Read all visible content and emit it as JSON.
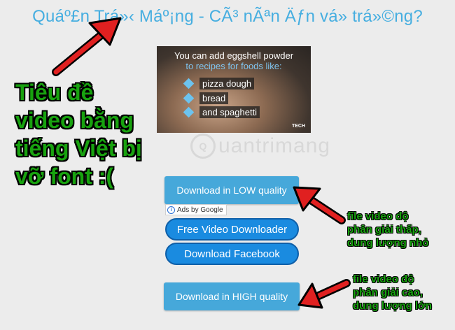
{
  "page": {
    "title": "Quáº£n Trá»‹ Máº¡ng - CÃ³ nÃªn Äƒn vá» trá»©ng?"
  },
  "annotations": {
    "left_note": "Tiêu đề video bằng tiếng Việt bị vỡ font :(",
    "low_note_lines": [
      "file video độ",
      "phân giải thấp,",
      "dung lượng nhỏ"
    ],
    "high_note_lines": [
      "file video độ",
      "phân giải cao,",
      "dung lượng lớn"
    ]
  },
  "thumbnail": {
    "caption_line1": "You can add eggshell powder",
    "caption_line2": "to recipes for foods like:",
    "bullets": [
      "pizza dough",
      "bread",
      "and spaghetti"
    ],
    "brand": "TECH"
  },
  "watermark": {
    "text": "uantrimang"
  },
  "buttons": {
    "low_quality": "Download in LOW quality",
    "free_downloader": "Free Video Downloader",
    "download_facebook": "Download Facebook",
    "high_quality": "Download in HIGH quality"
  },
  "ads": {
    "label": "Ads by Google",
    "info_glyph": "i"
  },
  "colors": {
    "title": "#46aee0",
    "annotation_green": "#18a20f",
    "arrow_red": "#e02020",
    "quality_button": "#46a8da",
    "pill_button": "#1a8be0"
  }
}
